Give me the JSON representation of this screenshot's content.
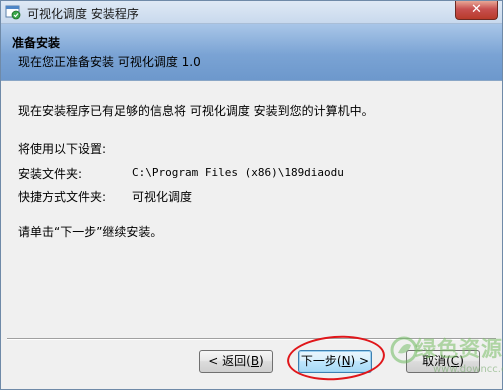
{
  "window": {
    "title": "可视化调度 安装程序",
    "close_glyph": "✕"
  },
  "header": {
    "title": "准备安装",
    "subtitle": "现在您正准备安装 可视化调度 1.0"
  },
  "content": {
    "intro": "现在安装程序已有足够的信息将 可视化调度 安装到您的计算机中。",
    "settings_heading": "将使用以下设置:",
    "install_folder_label": "安装文件夹:",
    "install_folder_value": "C:\\Program Files (x86)\\189diaodu",
    "shortcut_folder_label": "快捷方式文件夹:",
    "shortcut_folder_value": "可视化调度",
    "instruction": "请单击“下一步”继续安装。"
  },
  "buttons": {
    "back": {
      "prefix": "< 返回(",
      "key": "B",
      "suffix": ")"
    },
    "next": {
      "prefix": "下一步(",
      "key": "N",
      "suffix": ") >"
    },
    "cancel": {
      "prefix": "取消(",
      "key": "C",
      "suffix": ")"
    }
  },
  "watermark": {
    "text": "绿色资源网",
    "url": "www.downcc.com"
  },
  "colors": {
    "header_gradient_top": "#a9c6e8",
    "header_gradient_bottom": "#6d98cc",
    "highlight_circle": "#e0161a",
    "close_button": "#c75050"
  },
  "icons": {
    "app": "installer-app-icon",
    "close": "close-icon",
    "watermark_logo": "leaf-logo-icon"
  }
}
